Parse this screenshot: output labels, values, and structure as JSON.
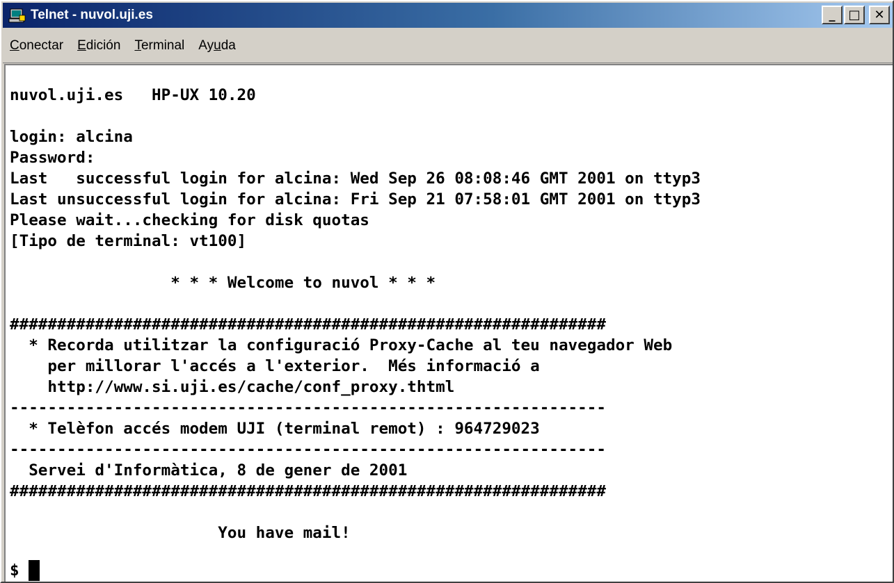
{
  "window": {
    "title": "Telnet - nuvol.uji.es",
    "icon": "telnet-computer-icon",
    "buttons": {
      "minimize": "_",
      "maximize": "□",
      "close": "✕"
    }
  },
  "menu": {
    "items": [
      {
        "pre": "",
        "accel": "C",
        "post": "onectar"
      },
      {
        "pre": "",
        "accel": "E",
        "post": "dición"
      },
      {
        "pre": "",
        "accel": "T",
        "post": "erminal"
      },
      {
        "pre": "Ay",
        "accel": "u",
        "post": "da"
      }
    ]
  },
  "terminal": {
    "lines": [
      "nuvol.uji.es   HP-UX 10.20",
      "",
      "login: alcina",
      "Password:",
      "Last   successful login for alcina: Wed Sep 26 08:08:46 GMT 2001 on ttyp3",
      "Last unsuccessful login for alcina: Fri Sep 21 07:58:01 GMT 2001 on ttyp3",
      "Please wait...checking for disk quotas",
      "[Tipo de terminal: vt100]",
      "",
      "                 * * * Welcome to nuvol * * *",
      "",
      "###############################################################",
      "  * Recorda utilitzar la configuració Proxy-Cache al teu navegador Web",
      "    per millorar l'accés a l'exterior.  Més informació a",
      "    http://www.si.uji.es/cache/conf_proxy.thtml",
      "---------------------------------------------------------------",
      "  * Telèfon accés modem UJI (terminal remot) : 964729023",
      "---------------------------------------------------------------",
      "  Servei d'Informàtica, 8 de gener de 2001",
      "###############################################################",
      "",
      "                      You have mail!",
      "",
      "$ "
    ]
  },
  "colors": {
    "titlebar_start": "#0a246a",
    "titlebar_end": "#a6caf0",
    "terminal_bg": "#ffffff",
    "terminal_fg": "#000000",
    "chrome": "#d4d0c8"
  }
}
